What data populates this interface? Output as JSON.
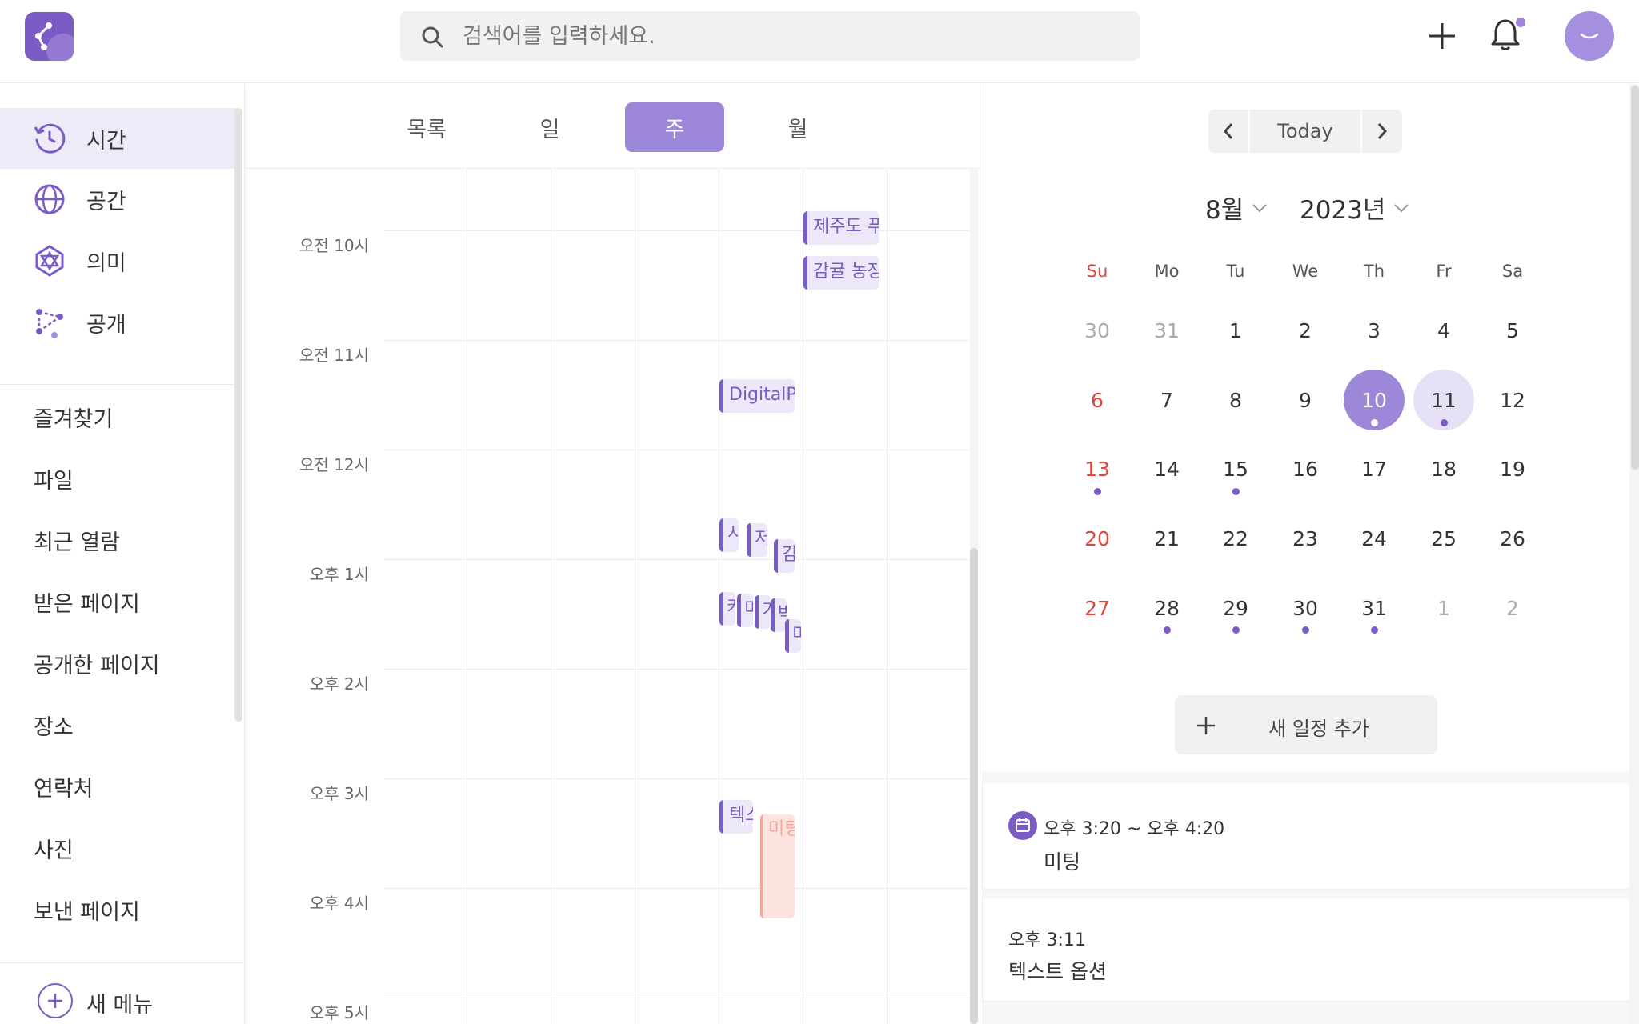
{
  "header": {
    "search_placeholder": "검색어를 입력하세요."
  },
  "sidebar": {
    "main_items": [
      {
        "label": "시간",
        "icon": "clock-icon"
      },
      {
        "label": "공간",
        "icon": "globe-icon"
      },
      {
        "label": "의미",
        "icon": "network-icon"
      },
      {
        "label": "공개",
        "icon": "share-icon"
      }
    ],
    "links": [
      "즐겨찾기",
      "파일",
      "최근 열람",
      "받은 페이지",
      "공개한 페이지",
      "장소",
      "연락처",
      "사진",
      "보낸 페이지"
    ],
    "new_menu_label": "새 메뉴"
  },
  "view_tabs": [
    "목록",
    "일",
    "주",
    "월"
  ],
  "active_tab": "주",
  "timeline": {
    "hours": [
      "오전 10시",
      "오전 11시",
      "오전 12시",
      "오후 1시",
      "오후 2시",
      "오후 3시",
      "오후 4시",
      "오후 5시"
    ],
    "events": [
      "제주도 푸",
      "감귤 농장",
      "DigitalP",
      "시",
      "저",
      "감",
      "카",
      "미",
      "기",
      "박",
      "미",
      "텍스",
      "미팅"
    ]
  },
  "mini_calendar": {
    "today_label": "Today",
    "month_label": "8월",
    "year_label": "2023년",
    "weekdays": [
      "Su",
      "Mo",
      "Tu",
      "We",
      "Th",
      "Fr",
      "Sa"
    ],
    "weeks": [
      [
        "30",
        "31",
        "1",
        "2",
        "3",
        "4",
        "5"
      ],
      [
        "6",
        "7",
        "8",
        "9",
        "10",
        "11",
        "12"
      ],
      [
        "13",
        "14",
        "15",
        "16",
        "17",
        "18",
        "19"
      ],
      [
        "20",
        "21",
        "22",
        "23",
        "24",
        "25",
        "26"
      ],
      [
        "27",
        "28",
        "29",
        "30",
        "31",
        "1",
        "2"
      ]
    ],
    "selected_day": "10",
    "highlighted_day": "11"
  },
  "add_event_label": "새 일정 추가",
  "schedule": [
    {
      "time": "오후 3:20 ~ 오후 4:20",
      "title": "미팅"
    },
    {
      "time": "오후 3:11",
      "title": "텍스트 옵션"
    }
  ],
  "colors": {
    "accent": "#7a5cc4",
    "accent_light": "#9c87d9",
    "highlight": "#e7e1f6",
    "sunday": "#e0453c",
    "pink_event": "#f3a59a"
  }
}
